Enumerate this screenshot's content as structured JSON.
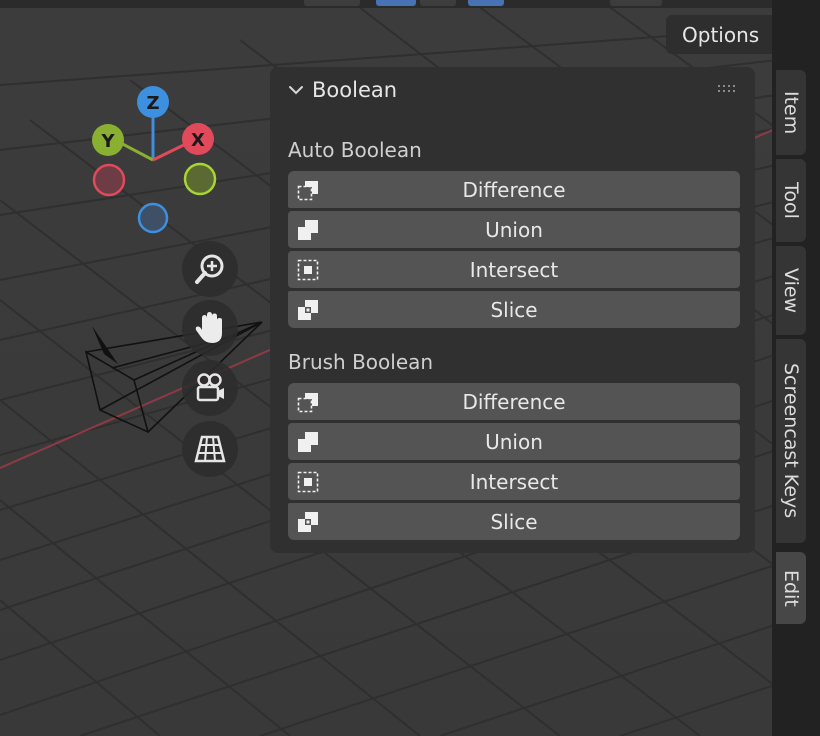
{
  "header": {
    "options_label": "Options"
  },
  "gizmo": {
    "axis_z": "Z",
    "axis_y": "Y",
    "axis_x": "X"
  },
  "nav_tools": {
    "zoom": "zoom-icon",
    "pan": "hand-icon",
    "camera": "camera-icon",
    "ortho": "grid-perspective-icon"
  },
  "panel": {
    "title": "Boolean",
    "auto_section": {
      "label": "Auto Boolean",
      "buttons": [
        {
          "label": "Difference",
          "icon": "difference-icon"
        },
        {
          "label": "Union",
          "icon": "union-icon"
        },
        {
          "label": "Intersect",
          "icon": "intersect-icon"
        },
        {
          "label": "Slice",
          "icon": "slice-icon"
        }
      ]
    },
    "brush_section": {
      "label": "Brush Boolean",
      "buttons": [
        {
          "label": "Difference",
          "icon": "difference-icon"
        },
        {
          "label": "Union",
          "icon": "union-icon"
        },
        {
          "label": "Intersect",
          "icon": "intersect-icon"
        },
        {
          "label": "Slice",
          "icon": "slice-icon"
        }
      ]
    }
  },
  "sidebar_tabs": [
    "Item",
    "Tool",
    "View",
    "Screencast Keys",
    "Edit"
  ],
  "colors": {
    "viewport_bg": "#3a3a3a",
    "axis_x": "#e04a5a",
    "axis_y": "#8ab031",
    "axis_z": "#3d8fe0",
    "button_bg": "#545454",
    "panel_bg": "#303030"
  }
}
